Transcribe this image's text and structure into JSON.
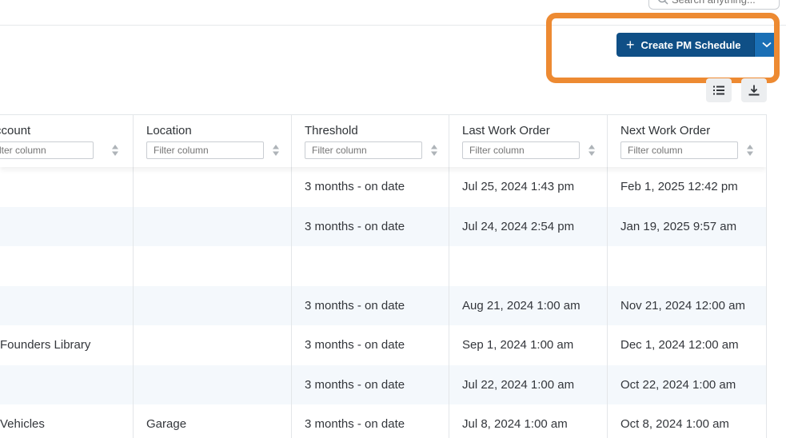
{
  "header": {
    "search_placeholder": "Search anything..."
  },
  "toolbar": {
    "create_label": "Create PM Schedule",
    "create_icon": "plus-icon",
    "split_icon": "chevron-down-icon",
    "columns_icon": "list-icon",
    "download_icon": "download-icon"
  },
  "colors": {
    "primary": "#0f4f86",
    "highlight": "#ed8a32"
  },
  "table": {
    "columns": [
      {
        "label": "Account",
        "filter_placeholder": "Filter column"
      },
      {
        "label": "Location",
        "filter_placeholder": "Filter column"
      },
      {
        "label": "Threshold",
        "filter_placeholder": "Filter column"
      },
      {
        "label": "Last Work Order",
        "filter_placeholder": "Filter column"
      },
      {
        "label": "Next Work Order",
        "filter_placeholder": "Filter column"
      }
    ],
    "rows": [
      [
        "",
        "",
        "3 months - on date",
        "Jul 25, 2024 1:43 pm",
        "Feb 1, 2025 12:42 pm"
      ],
      [
        "",
        "",
        "3 months - on date",
        "Jul 24, 2024 2:54 pm",
        "Jan 19, 2025 9:57 am"
      ],
      [
        "",
        "",
        "",
        "",
        ""
      ],
      [
        "",
        "",
        "3 months - on date",
        "Aug 21, 2024 1:00 am",
        "Nov 21, 2024 12:00 am"
      ],
      [
        "Founders Library",
        "",
        "3 months - on date",
        "Sep 1, 2024 1:00 am",
        "Dec 1, 2024 12:00 am"
      ],
      [
        "",
        "",
        "3 months - on date",
        "Jul 22, 2024 1:00 am",
        "Oct 22, 2024 1:00 am"
      ],
      [
        "Vehicles",
        "Garage",
        "3 months - on date",
        "Jul 8, 2024 1:00 am",
        "Oct 8, 2024 1:00 am"
      ]
    ]
  }
}
